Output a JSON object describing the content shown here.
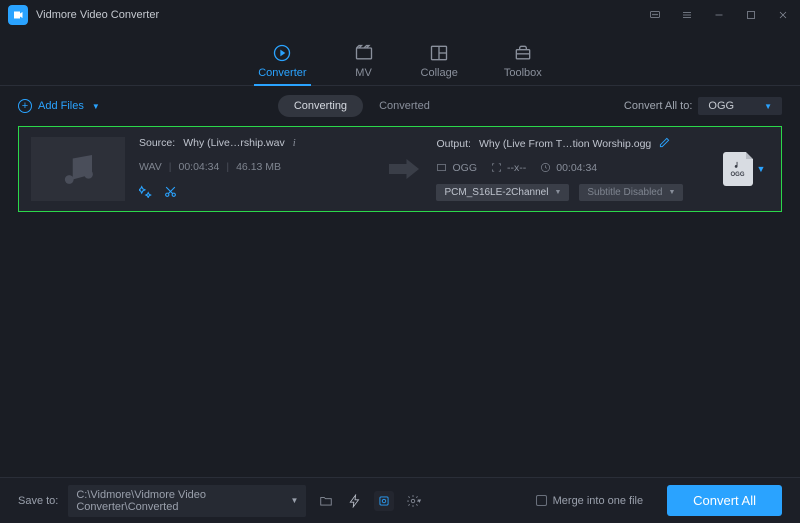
{
  "app": {
    "title": "Vidmore Video Converter"
  },
  "main_tabs": {
    "converter": "Converter",
    "mv": "MV",
    "collage": "Collage",
    "toolbox": "Toolbox"
  },
  "toolbar": {
    "add_files": "Add Files",
    "subtab_converting": "Converting",
    "subtab_converted": "Converted",
    "convert_all_label": "Convert All to:",
    "convert_all_value": "OGG"
  },
  "file": {
    "source_label": "Source:",
    "source_name": "Why (Live…rship.wav",
    "format_in": "WAV",
    "duration": "00:04:34",
    "size": "46.13 MB",
    "output_label": "Output:",
    "output_name": "Why (Live From T…tion Worship.ogg",
    "format_out": "OGG",
    "resolution": "--x--",
    "duration_out": "00:04:34",
    "audio_codec": "PCM_S16LE-2Channel",
    "subtitle": "Subtitle Disabled",
    "fmt_ext": "OGG"
  },
  "footer": {
    "save_label": "Save to:",
    "save_path": "C:\\Vidmore\\Vidmore Video Converter\\Converted",
    "merge_label": "Merge into one file",
    "convert_btn": "Convert All"
  }
}
